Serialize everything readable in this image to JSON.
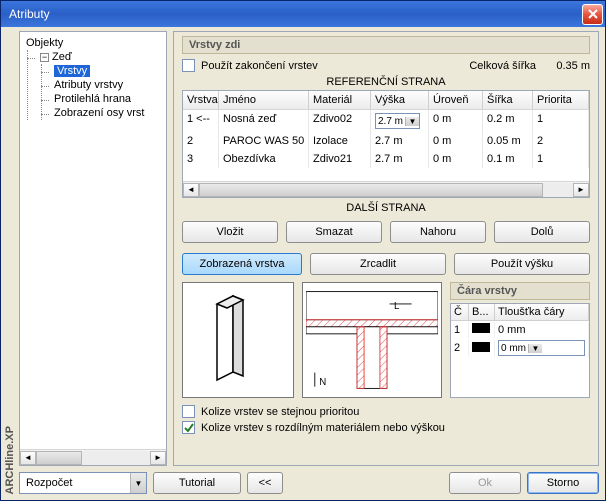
{
  "window": {
    "title": "Atributy"
  },
  "vertical_brand": "ARCHline.XP",
  "tree": {
    "root_label": "Objekty",
    "zed_label": "Zeď",
    "items": [
      "Vrstvy",
      "Atributy vrstvy",
      "Protilehlá hrana",
      "Zobrazení osy vrst"
    ]
  },
  "panel": {
    "group_title": "Vrstvy zdi",
    "use_end_label": "Použít zakončení vrstev",
    "total_width_label": "Celková šířka",
    "total_width_value": "0.35 m",
    "ref_side_label": "REFERENČNÍ STRANA",
    "other_side_label": "DALŠÍ STRANA",
    "columns": [
      "Vrstva",
      "Jméno",
      "Materiál",
      "Výška",
      "Úroveň",
      "Šířka",
      "Priorita"
    ],
    "rows": [
      {
        "n": "1 <--",
        "name": "Nosná zeď",
        "mat": "Zdivo02",
        "h": "2.7 m",
        "lvl": "0 m",
        "w": "0.2 m",
        "p": "1",
        "combo": true
      },
      {
        "n": "2",
        "name": "PAROC WAS 50",
        "mat": "Izolace",
        "h": "2.7 m",
        "lvl": "0 m",
        "w": "0.05 m",
        "p": "2",
        "combo": false
      },
      {
        "n": "3",
        "name": "Obezdívka",
        "mat": "Zdivo21",
        "h": "2.7 m",
        "lvl": "0 m",
        "w": "0.1 m",
        "p": "1",
        "combo": false
      }
    ],
    "btns": {
      "insert": "Vložit",
      "delete": "Smazat",
      "up": "Nahoru",
      "down": "Dolů"
    },
    "btns2": {
      "shown": "Zobrazená vrstva",
      "mirror": "Zrcadlit",
      "useheight": "Použít výšku"
    },
    "lines": {
      "title": "Čára vrstvy",
      "cols": [
        "Č",
        "B...",
        "Tloušťka čáry"
      ],
      "rows": [
        {
          "n": "1",
          "t": "0 mm",
          "combo": false
        },
        {
          "n": "2",
          "t": "0 mm",
          "combo": true
        }
      ]
    },
    "checks": {
      "same": "Kolize vrstev se stejnou prioritou",
      "diff": "Kolize vrstev s rozdílným materiálem nebo výškou"
    }
  },
  "footer": {
    "select_value": "Rozpočet",
    "tutorial": "Tutorial",
    "back": "<<",
    "ok": "Ok",
    "storno": "Storno"
  }
}
